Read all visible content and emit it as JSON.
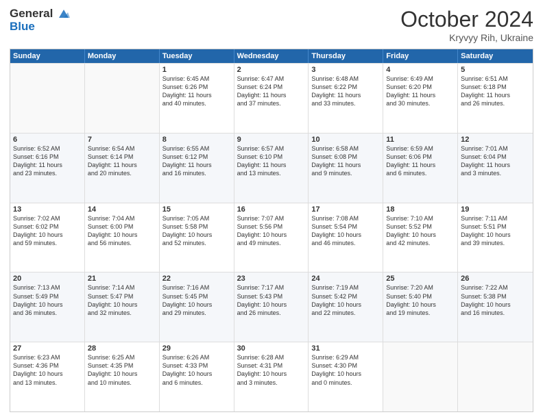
{
  "header": {
    "logo_line1": "General",
    "logo_line2": "Blue",
    "month_year": "October 2024",
    "location": "Kryvyy Rih, Ukraine"
  },
  "weekdays": [
    "Sunday",
    "Monday",
    "Tuesday",
    "Wednesday",
    "Thursday",
    "Friday",
    "Saturday"
  ],
  "rows": [
    [
      {
        "day": "",
        "sunrise": "",
        "sunset": "",
        "daylight": ""
      },
      {
        "day": "",
        "sunrise": "",
        "sunset": "",
        "daylight": ""
      },
      {
        "day": "1",
        "sunrise": "Sunrise: 6:45 AM",
        "sunset": "Sunset: 6:26 PM",
        "daylight": "Daylight: 11 hours and 40 minutes."
      },
      {
        "day": "2",
        "sunrise": "Sunrise: 6:47 AM",
        "sunset": "Sunset: 6:24 PM",
        "daylight": "Daylight: 11 hours and 37 minutes."
      },
      {
        "day": "3",
        "sunrise": "Sunrise: 6:48 AM",
        "sunset": "Sunset: 6:22 PM",
        "daylight": "Daylight: 11 hours and 33 minutes."
      },
      {
        "day": "4",
        "sunrise": "Sunrise: 6:49 AM",
        "sunset": "Sunset: 6:20 PM",
        "daylight": "Daylight: 11 hours and 30 minutes."
      },
      {
        "day": "5",
        "sunrise": "Sunrise: 6:51 AM",
        "sunset": "Sunset: 6:18 PM",
        "daylight": "Daylight: 11 hours and 26 minutes."
      }
    ],
    [
      {
        "day": "6",
        "sunrise": "Sunrise: 6:52 AM",
        "sunset": "Sunset: 6:16 PM",
        "daylight": "Daylight: 11 hours and 23 minutes."
      },
      {
        "day": "7",
        "sunrise": "Sunrise: 6:54 AM",
        "sunset": "Sunset: 6:14 PM",
        "daylight": "Daylight: 11 hours and 20 minutes."
      },
      {
        "day": "8",
        "sunrise": "Sunrise: 6:55 AM",
        "sunset": "Sunset: 6:12 PM",
        "daylight": "Daylight: 11 hours and 16 minutes."
      },
      {
        "day": "9",
        "sunrise": "Sunrise: 6:57 AM",
        "sunset": "Sunset: 6:10 PM",
        "daylight": "Daylight: 11 hours and 13 minutes."
      },
      {
        "day": "10",
        "sunrise": "Sunrise: 6:58 AM",
        "sunset": "Sunset: 6:08 PM",
        "daylight": "Daylight: 11 hours and 9 minutes."
      },
      {
        "day": "11",
        "sunrise": "Sunrise: 6:59 AM",
        "sunset": "Sunset: 6:06 PM",
        "daylight": "Daylight: 11 hours and 6 minutes."
      },
      {
        "day": "12",
        "sunrise": "Sunrise: 7:01 AM",
        "sunset": "Sunset: 6:04 PM",
        "daylight": "Daylight: 11 hours and 3 minutes."
      }
    ],
    [
      {
        "day": "13",
        "sunrise": "Sunrise: 7:02 AM",
        "sunset": "Sunset: 6:02 PM",
        "daylight": "Daylight: 10 hours and 59 minutes."
      },
      {
        "day": "14",
        "sunrise": "Sunrise: 7:04 AM",
        "sunset": "Sunset: 6:00 PM",
        "daylight": "Daylight: 10 hours and 56 minutes."
      },
      {
        "day": "15",
        "sunrise": "Sunrise: 7:05 AM",
        "sunset": "Sunset: 5:58 PM",
        "daylight": "Daylight: 10 hours and 52 minutes."
      },
      {
        "day": "16",
        "sunrise": "Sunrise: 7:07 AM",
        "sunset": "Sunset: 5:56 PM",
        "daylight": "Daylight: 10 hours and 49 minutes."
      },
      {
        "day": "17",
        "sunrise": "Sunrise: 7:08 AM",
        "sunset": "Sunset: 5:54 PM",
        "daylight": "Daylight: 10 hours and 46 minutes."
      },
      {
        "day": "18",
        "sunrise": "Sunrise: 7:10 AM",
        "sunset": "Sunset: 5:52 PM",
        "daylight": "Daylight: 10 hours and 42 minutes."
      },
      {
        "day": "19",
        "sunrise": "Sunrise: 7:11 AM",
        "sunset": "Sunset: 5:51 PM",
        "daylight": "Daylight: 10 hours and 39 minutes."
      }
    ],
    [
      {
        "day": "20",
        "sunrise": "Sunrise: 7:13 AM",
        "sunset": "Sunset: 5:49 PM",
        "daylight": "Daylight: 10 hours and 36 minutes."
      },
      {
        "day": "21",
        "sunrise": "Sunrise: 7:14 AM",
        "sunset": "Sunset: 5:47 PM",
        "daylight": "Daylight: 10 hours and 32 minutes."
      },
      {
        "day": "22",
        "sunrise": "Sunrise: 7:16 AM",
        "sunset": "Sunset: 5:45 PM",
        "daylight": "Daylight: 10 hours and 29 minutes."
      },
      {
        "day": "23",
        "sunrise": "Sunrise: 7:17 AM",
        "sunset": "Sunset: 5:43 PM",
        "daylight": "Daylight: 10 hours and 26 minutes."
      },
      {
        "day": "24",
        "sunrise": "Sunrise: 7:19 AM",
        "sunset": "Sunset: 5:42 PM",
        "daylight": "Daylight: 10 hours and 22 minutes."
      },
      {
        "day": "25",
        "sunrise": "Sunrise: 7:20 AM",
        "sunset": "Sunset: 5:40 PM",
        "daylight": "Daylight: 10 hours and 19 minutes."
      },
      {
        "day": "26",
        "sunrise": "Sunrise: 7:22 AM",
        "sunset": "Sunset: 5:38 PM",
        "daylight": "Daylight: 10 hours and 16 minutes."
      }
    ],
    [
      {
        "day": "27",
        "sunrise": "Sunrise: 6:23 AM",
        "sunset": "Sunset: 4:36 PM",
        "daylight": "Daylight: 10 hours and 13 minutes."
      },
      {
        "day": "28",
        "sunrise": "Sunrise: 6:25 AM",
        "sunset": "Sunset: 4:35 PM",
        "daylight": "Daylight: 10 hours and 10 minutes."
      },
      {
        "day": "29",
        "sunrise": "Sunrise: 6:26 AM",
        "sunset": "Sunset: 4:33 PM",
        "daylight": "Daylight: 10 hours and 6 minutes."
      },
      {
        "day": "30",
        "sunrise": "Sunrise: 6:28 AM",
        "sunset": "Sunset: 4:31 PM",
        "daylight": "Daylight: 10 hours and 3 minutes."
      },
      {
        "day": "31",
        "sunrise": "Sunrise: 6:29 AM",
        "sunset": "Sunset: 4:30 PM",
        "daylight": "Daylight: 10 hours and 0 minutes."
      },
      {
        "day": "",
        "sunrise": "",
        "sunset": "",
        "daylight": ""
      },
      {
        "day": "",
        "sunrise": "",
        "sunset": "",
        "daylight": ""
      }
    ]
  ]
}
